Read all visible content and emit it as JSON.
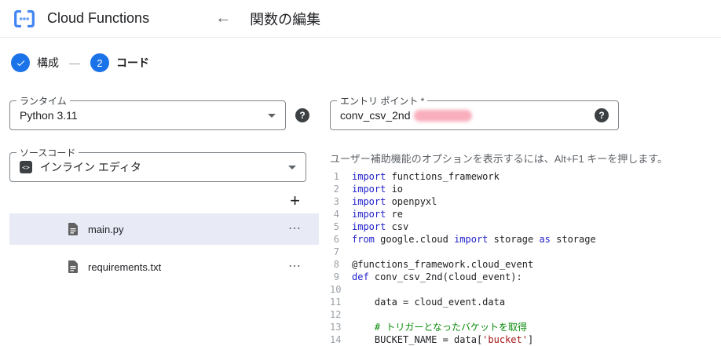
{
  "header": {
    "app_title": "Cloud Functions",
    "page_title": "関数の編集"
  },
  "stepper": {
    "step1_label": "構成",
    "step2_number": "2",
    "step2_label": "コード"
  },
  "left_panel": {
    "runtime_label": "ランタイム",
    "runtime_value": "Python 3.11",
    "source_label": "ソースコード",
    "source_value": "インライン エディタ",
    "add_button_label": "+",
    "file_menu_glyph": "⋯",
    "files": [
      {
        "name": "main.py",
        "selected": true
      },
      {
        "name": "requirements.txt",
        "selected": false
      }
    ]
  },
  "editor": {
    "entry_label": "エントリ ポイント *",
    "entry_value": "conv_csv_2nd",
    "entry_redacted": true,
    "accessibility_hint": "ユーザー補助機能のオプションを表示するには、Alt+F1 キーを押します。",
    "code_lines": [
      {
        "n": 1,
        "tokens": [
          [
            "kw",
            "import"
          ],
          [
            "pl",
            " functions_framework"
          ]
        ]
      },
      {
        "n": 2,
        "tokens": [
          [
            "kw",
            "import"
          ],
          [
            "pl",
            " io"
          ]
        ]
      },
      {
        "n": 3,
        "tokens": [
          [
            "kw",
            "import"
          ],
          [
            "pl",
            " openpyxl"
          ]
        ]
      },
      {
        "n": 4,
        "tokens": [
          [
            "kw",
            "import"
          ],
          [
            "pl",
            " re"
          ]
        ]
      },
      {
        "n": 5,
        "tokens": [
          [
            "kw",
            "import"
          ],
          [
            "pl",
            " csv"
          ]
        ]
      },
      {
        "n": 6,
        "tokens": [
          [
            "kw",
            "from"
          ],
          [
            "pl",
            " google.cloud "
          ],
          [
            "kw",
            "import"
          ],
          [
            "pl",
            " storage "
          ],
          [
            "kw",
            "as"
          ],
          [
            "pl",
            " storage"
          ]
        ]
      },
      {
        "n": 7,
        "tokens": []
      },
      {
        "n": 8,
        "tokens": [
          [
            "pl",
            "@functions_framework.cloud_event"
          ]
        ]
      },
      {
        "n": 9,
        "tokens": [
          [
            "kw",
            "def"
          ],
          [
            "pl",
            " conv_csv_2nd(cloud_event):"
          ]
        ]
      },
      {
        "n": 10,
        "tokens": []
      },
      {
        "n": 11,
        "tokens": [
          [
            "pl",
            "    data = cloud_event.data"
          ]
        ]
      },
      {
        "n": 12,
        "tokens": []
      },
      {
        "n": 13,
        "tokens": [
          [
            "cm",
            "    # トリガーとなったバケットを取得"
          ]
        ]
      },
      {
        "n": 14,
        "tokens": [
          [
            "pl",
            "    BUCKET_NAME = data["
          ],
          [
            "st",
            "'bucket'"
          ],
          [
            "pl",
            "]"
          ]
        ]
      }
    ]
  },
  "colors": {
    "accent": "#1a73e8",
    "keyword": "#2222cc",
    "comment": "#098a09",
    "string": "#a31515",
    "line_number": "#9aa0a6",
    "selected_file_bg": "#e8eaf6"
  }
}
